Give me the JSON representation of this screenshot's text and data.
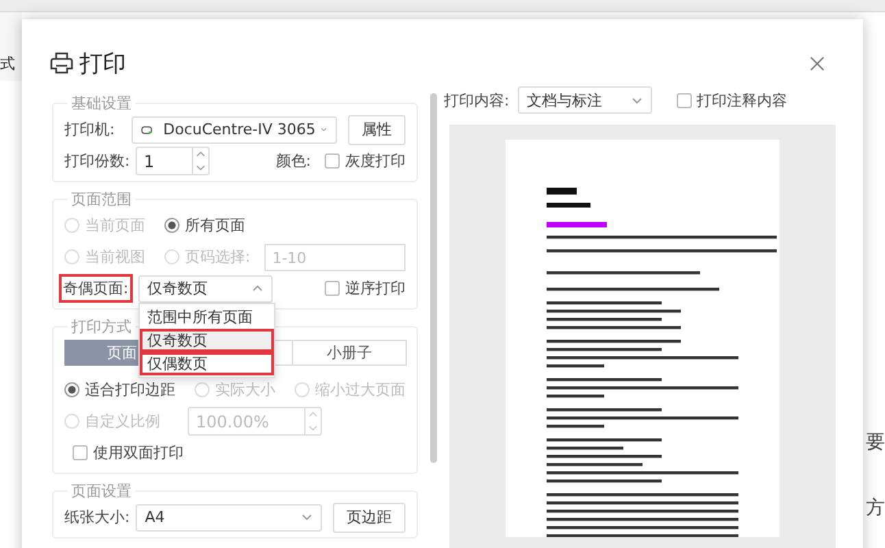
{
  "background": {
    "left_label": "式",
    "side_text": [
      "要",
      "方"
    ]
  },
  "dialog": {
    "title": "打印"
  },
  "basic": {
    "title": "基础设置",
    "printer_label": "打印机:",
    "printer": "DocuCentre-IV 3065",
    "properties_button": "属性",
    "copies_label": "打印份数:",
    "copies": "1",
    "color_label": "颜色:",
    "grayscale": {
      "label": "灰度打印",
      "checked": false
    }
  },
  "range": {
    "title": "页面范围",
    "options": [
      {
        "label": "当前页面",
        "selected": false,
        "disabled": true
      },
      {
        "label": "所有页面",
        "selected": true,
        "disabled": false
      },
      {
        "label": "当前视图",
        "selected": false,
        "disabled": true
      },
      {
        "label": "页码选择:",
        "selected": false,
        "disabled": true
      }
    ],
    "pages_value": "1-10",
    "odd_even_label": "奇偶页面:",
    "odd_even_highlighted": true,
    "odd_even_value": "仅奇数页",
    "reverse": {
      "label": "逆序打印",
      "checked": false
    },
    "dropdown": [
      {
        "label": "范围中所有页面",
        "selected": false,
        "highlighted": false
      },
      {
        "label": "仅奇数页",
        "selected": true,
        "highlighted": true
      },
      {
        "label": "仅偶数页",
        "selected": false,
        "highlighted": true
      }
    ]
  },
  "mode": {
    "title": "打印方式",
    "tabs": [
      {
        "label": "页面",
        "selected": true
      },
      {
        "selected": false
      },
      {
        "label": "小册子",
        "selected": false
      }
    ],
    "scale_options": [
      {
        "label": "适合打印边距",
        "selected": true,
        "disabled": false
      },
      {
        "label": "实际大小",
        "selected": false,
        "disabled": true
      },
      {
        "label": "缩小过大页面",
        "selected": false,
        "disabled": true
      }
    ],
    "custom_scale": {
      "label": "自定义比例",
      "selected": false,
      "disabled": true,
      "value": "100.00%"
    },
    "duplex": {
      "label": "使用双面打印",
      "checked": false
    }
  },
  "page_setup": {
    "title": "页面设置",
    "paper_label": "纸张大小:",
    "paper": "A4",
    "margins_button": "页边距"
  },
  "preview": {
    "content_label": "打印内容:",
    "content": "文档与标注",
    "annotations": {
      "label": "打印注释内容",
      "checked": false
    }
  }
}
